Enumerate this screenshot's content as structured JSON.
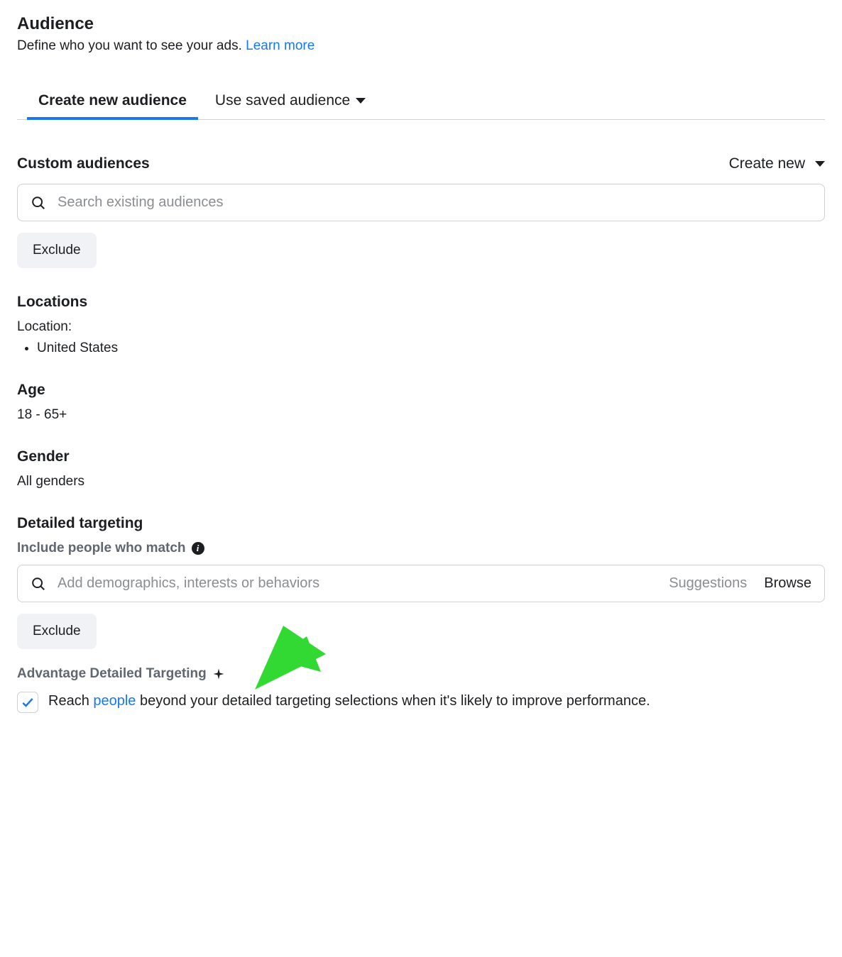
{
  "header": {
    "title": "Audience",
    "description": "Define who you want to see your ads.",
    "learn_more": "Learn more"
  },
  "tabs": {
    "create_new": "Create new audience",
    "use_saved": "Use saved audience"
  },
  "custom_audiences": {
    "label": "Custom audiences",
    "create_new": "Create new",
    "search_placeholder": "Search existing audiences",
    "exclude": "Exclude"
  },
  "locations": {
    "label": "Locations",
    "sublabel": "Location:",
    "items": [
      "United States"
    ]
  },
  "age": {
    "label": "Age",
    "value": "18 - 65+"
  },
  "gender": {
    "label": "Gender",
    "value": "All genders"
  },
  "detailed_targeting": {
    "label": "Detailed targeting",
    "include_label": "Include people who match",
    "placeholder": "Add demographics, interests or behaviors",
    "suggestions": "Suggestions",
    "browse": "Browse",
    "exclude": "Exclude"
  },
  "advantage": {
    "label": "Advantage Detailed Targeting",
    "text_prefix": "Reach ",
    "text_link": "people",
    "text_suffix": " beyond your detailed targeting selections when it's likely to improve performance.",
    "checked": true
  }
}
